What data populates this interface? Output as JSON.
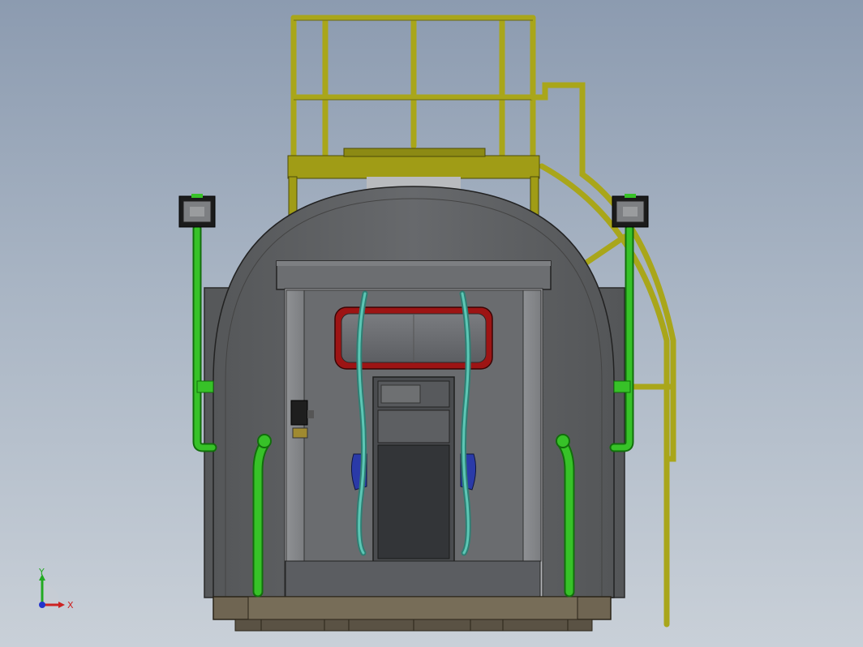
{
  "triad": {
    "x_label": "X",
    "y_label": "Y",
    "x_color": "#cc2222",
    "y_color": "#22aa22",
    "z_color": "#2233cc"
  },
  "colors": {
    "background_top": "#8c9bb0",
    "background_bottom": "#c9d0d8",
    "railing": "#a9a61a",
    "body": "#5f6164",
    "window_frame": "#a01818",
    "pipe": "#2fae22",
    "hose": "#3fb0a0",
    "base_frame": "#6f6552"
  },
  "icons": {
    "triad": "coordinate-triad-icon",
    "lamp": "floodlight-icon"
  }
}
